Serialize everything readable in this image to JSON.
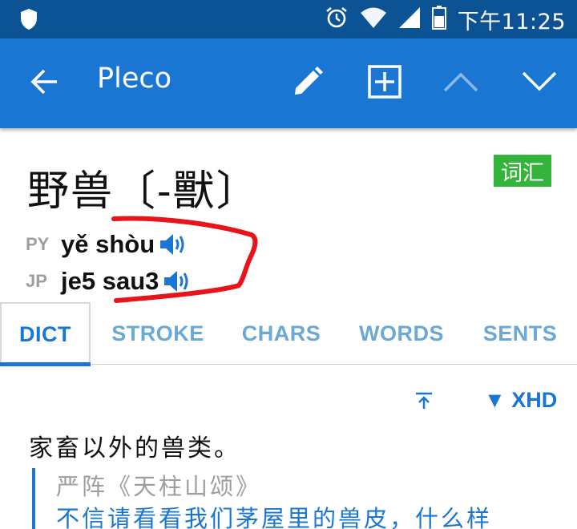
{
  "status_bar": {
    "time": "下午11:25",
    "icons": [
      "shield-icon",
      "alarm-icon",
      "wifi-icon",
      "signal-icon",
      "battery-icon"
    ]
  },
  "app_bar": {
    "title": "Pleco",
    "icons": [
      "back-arrow-icon",
      "edit-icon",
      "add-box-icon",
      "chevron-up-icon",
      "chevron-down-icon"
    ],
    "color": "#1976d2"
  },
  "entry": {
    "headword": "野兽〔-獸〕",
    "badge": "词汇",
    "badge_color": "#33b43a",
    "pronunciations": [
      {
        "tag": "PY",
        "value": "yě shòu"
      },
      {
        "tag": "JP",
        "value": "je5 sau3"
      }
    ]
  },
  "tabs": [
    {
      "label": "DICT",
      "active": true
    },
    {
      "label": "STROKE",
      "active": false
    },
    {
      "label": "CHARS",
      "active": false
    },
    {
      "label": "WORDS",
      "active": false
    },
    {
      "label": "SENTS",
      "active": false
    }
  ],
  "definition": {
    "source_label": "▼ XHD",
    "text": "家畜以外的兽类。",
    "example_source": "严阵《天柱山颂》",
    "example_text": "不信请看看我们茅屋里的兽皮，什么样"
  },
  "colors": {
    "accent": "#1976d2",
    "status_bar": "#0b5394",
    "annotation": "#e8141c"
  }
}
